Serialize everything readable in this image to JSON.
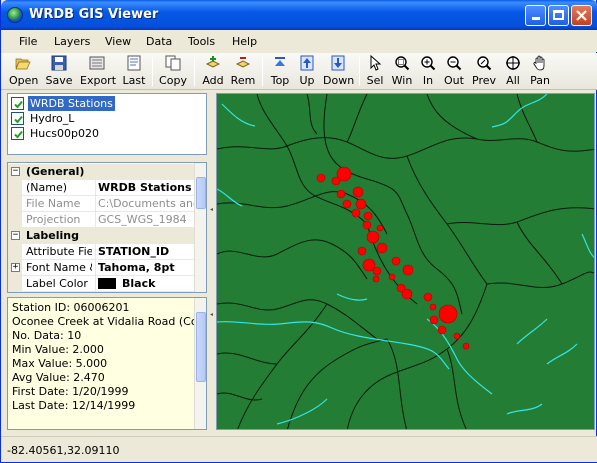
{
  "window": {
    "title": "WRDB GIS Viewer"
  },
  "menu": [
    "File",
    "Layers",
    "View",
    "Data",
    "Tools",
    "Help"
  ],
  "toolbar": {
    "open": "Open",
    "save": "Save",
    "export": "Export",
    "last": "Last",
    "copy": "Copy",
    "add": "Add",
    "rem": "Rem",
    "top": "Top",
    "up": "Up",
    "down": "Down",
    "sel": "Sel",
    "win": "Win",
    "in": "In",
    "out": "Out",
    "prev": "Prev",
    "all": "All",
    "pan": "Pan"
  },
  "layers": [
    {
      "name": "WRDB Stations",
      "checked": true,
      "selected": true
    },
    {
      "name": "Hydro_L",
      "checked": true,
      "selected": false
    },
    {
      "name": "Hucs00p020",
      "checked": true,
      "selected": false
    }
  ],
  "properties": {
    "general_header": "(General)",
    "name_label": "(Name)",
    "name_value": "WRDB Stations",
    "file_label": "File Name",
    "file_value": "C:\\Documents and",
    "proj_label": "Projection",
    "proj_value": "GCS_WGS_1984",
    "labeling_header": "Labeling",
    "attr_label": "Attribute Field",
    "attr_value": "STATION_ID",
    "font_label": "Font Name &",
    "font_value": "Tahoma, 8pt",
    "color_label": "Label Color",
    "color_value": "Black"
  },
  "info": {
    "station_id": "Station ID: 06006201",
    "station_name": "Oconee Creek at Vidalia Road (Cour",
    "no_data": "No. Data: 10",
    "min": "Min Value: 2.000",
    "max": "Max Value: 5.000",
    "avg": "Avg Value: 2.470",
    "first": "First Date: 1/20/1999",
    "last": "Last Date: 12/14/1999"
  },
  "status": {
    "coords": "-82.40561,32.09110"
  },
  "colors": {
    "map_land": "#237d35",
    "map_ocean": "#237d35",
    "river": "#32e6e6",
    "boundary": "#0a1a0a",
    "station": "#ff0000",
    "selection": "#316ac5"
  },
  "icons": {
    "open": "folder-open-icon",
    "save": "floppy-icon",
    "export": "export-icon",
    "last": "last-icon",
    "copy": "copy-icon",
    "add": "add-layer-icon",
    "rem": "remove-layer-icon",
    "top": "move-top-icon",
    "up": "move-up-icon",
    "down": "move-down-icon",
    "sel": "select-arrow-icon",
    "win": "zoom-window-icon",
    "in": "zoom-in-icon",
    "out": "zoom-out-icon",
    "prev": "zoom-prev-icon",
    "all": "zoom-all-icon",
    "pan": "pan-hand-icon"
  }
}
